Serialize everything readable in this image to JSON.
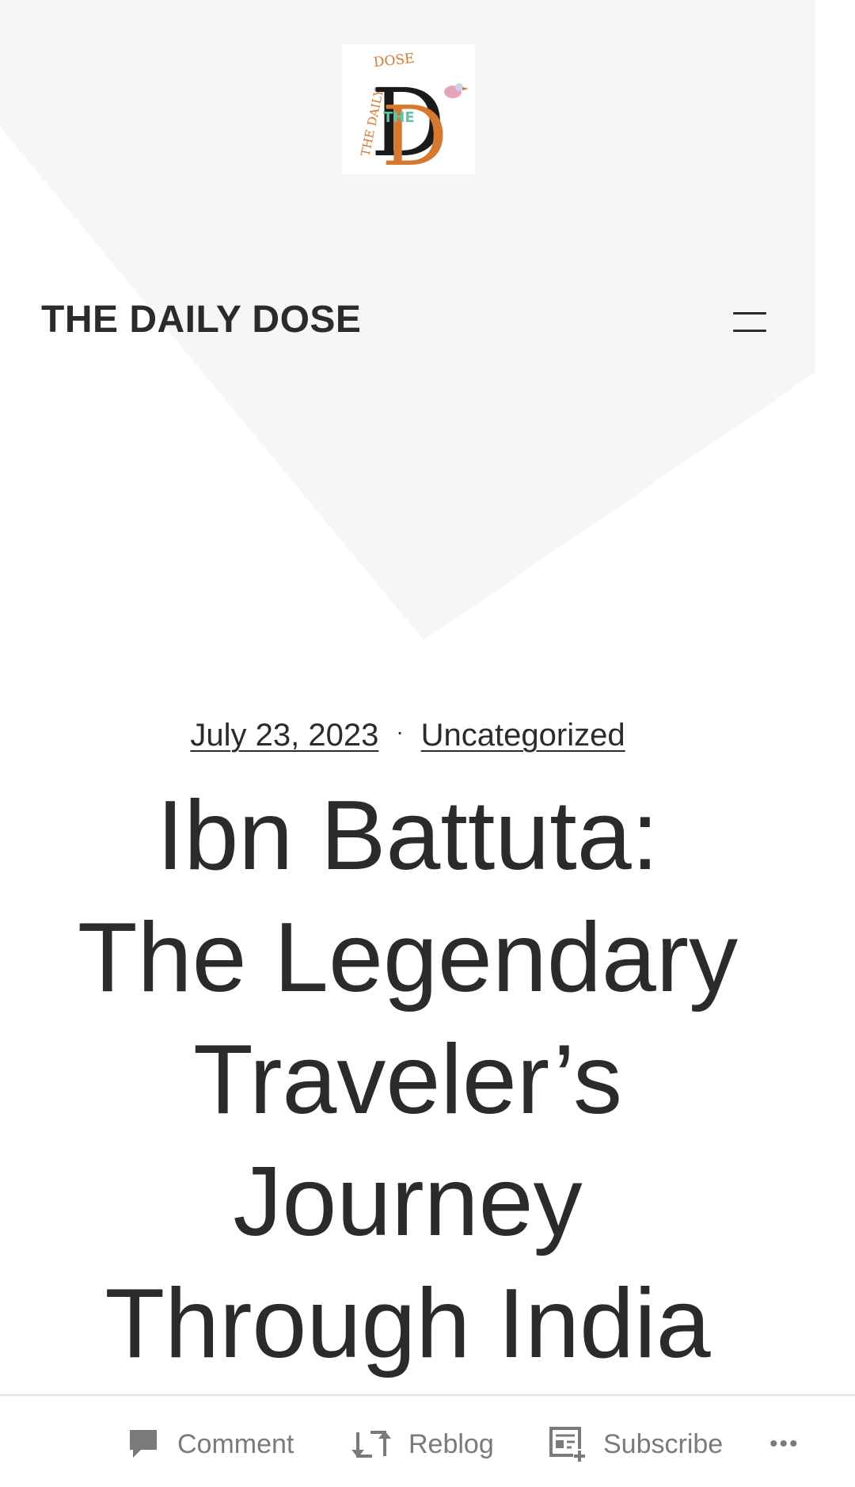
{
  "header": {
    "logo": {
      "top_text": "DOSE",
      "side_text": "THE DAILY",
      "center_text": "THE",
      "letters": "DD",
      "colors": {
        "black": "#1a1a1a",
        "orange": "#d8782e",
        "teal": "#5fc6a5"
      }
    },
    "site_title": "THE DAILY DOSE",
    "menu_icon": "hamburger-menu-icon"
  },
  "post": {
    "date": "July 23, 2023",
    "separator": "·",
    "category": "Uncategorized",
    "title_lines": [
      "Ibn Battuta:",
      "The Legendary",
      "Traveler’s",
      "Journey",
      "Through India"
    ]
  },
  "action_bar": {
    "comment": {
      "label": "Comment",
      "icon": "comment-bubble-icon"
    },
    "reblog": {
      "label": "Reblog",
      "icon": "reblog-arrows-icon"
    },
    "subscribe": {
      "label": "Subscribe",
      "icon": "subscribe-reader-icon"
    },
    "more": {
      "label": "•••",
      "icon": "more-dots-icon"
    }
  },
  "colors": {
    "text": "#2b2b2b",
    "background": "#ffffff",
    "background_shape": "#f6f6f6",
    "action_text": "#7a7a7a"
  }
}
